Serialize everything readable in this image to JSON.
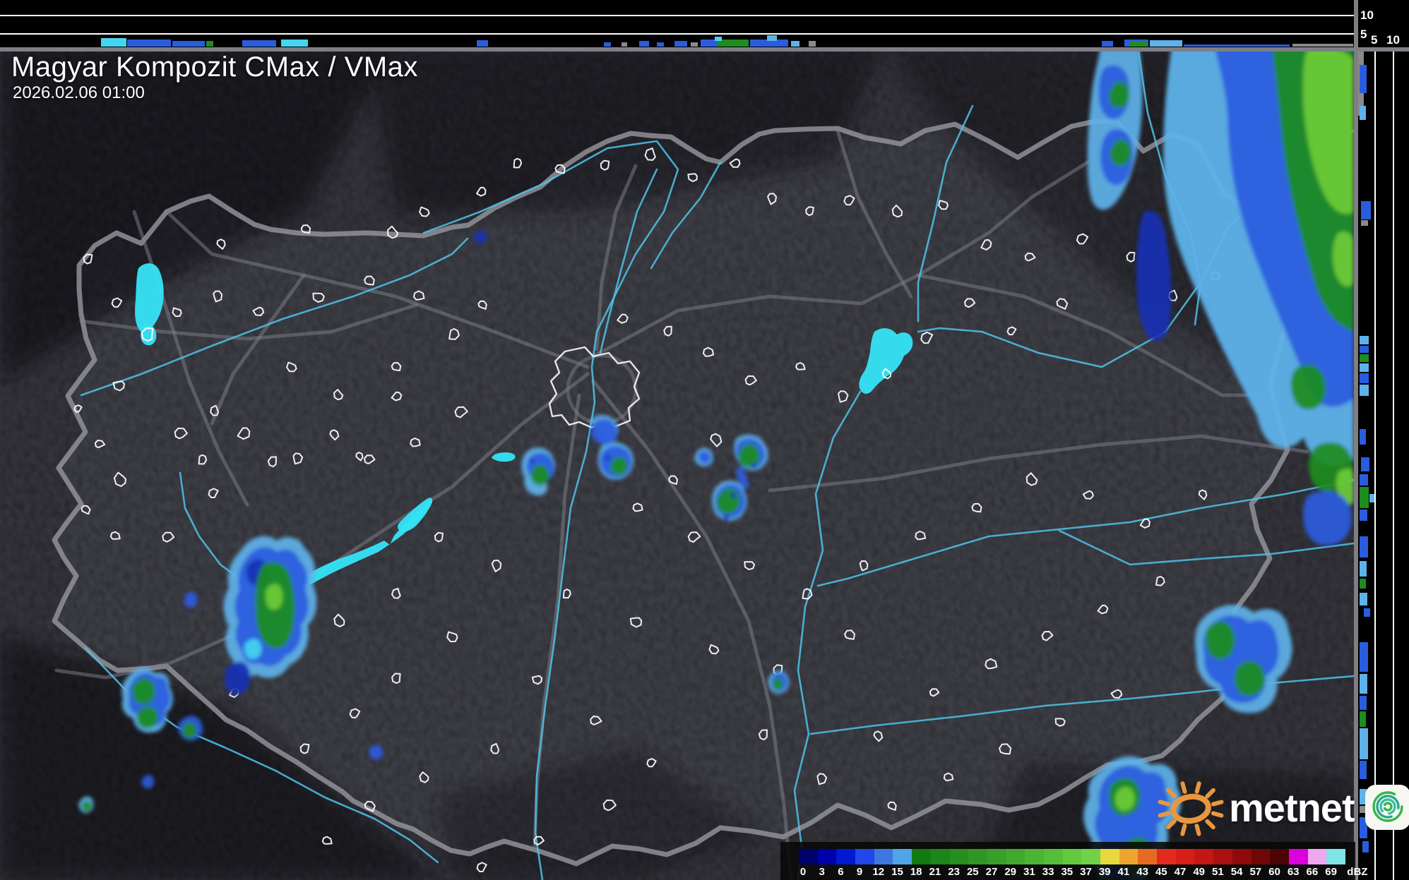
{
  "header": {
    "title": "Magyar Kompozit CMax / VMax",
    "timestamp": "2026.02.06 01:00"
  },
  "colorbar": {
    "unit": "dBZ",
    "ticks": [
      "0",
      "3",
      "6",
      "9",
      "12",
      "15",
      "18",
      "21",
      "23",
      "25",
      "27",
      "29",
      "31",
      "33",
      "35",
      "37",
      "39",
      "41",
      "43",
      "45",
      "47",
      "49",
      "51",
      "54",
      "57",
      "60",
      "63",
      "66",
      "69"
    ],
    "colors": [
      "#00006B",
      "#0000A8",
      "#0018CF",
      "#2346E8",
      "#3C78E0",
      "#4FA5E6",
      "#117A11",
      "#1E851B",
      "#278E20",
      "#309724",
      "#38A029",
      "#41AA2E",
      "#4BB434",
      "#55BE39",
      "#62C93F",
      "#70D246",
      "#E8D83C",
      "#EDA52F",
      "#E76A22",
      "#E22B1D",
      "#D81E18",
      "#C41714",
      "#AB1010",
      "#8F0B0B",
      "#6F0707",
      "#4A0404",
      "#DC00DC",
      "#EFA8EF",
      "#7FE4E4"
    ]
  },
  "profile_panels": {
    "top_axis_labels": [
      "10",
      "5"
    ],
    "right_axis_labels": [
      "5",
      "10"
    ]
  },
  "logo": {
    "text": "metnet",
    "sun_color": "#E8973F",
    "spiral_colors": [
      "#34B44A",
      "#2AA886",
      "#39BDA8"
    ]
  },
  "map_palette": {
    "background": "#3D3D45",
    "border": "#97979F",
    "road": "#80808A",
    "river": "#4FC3E8",
    "lake": "#35E2F5",
    "town_outline": "#FFFFFF",
    "echo_lightblue": "#5EB2EA",
    "echo_blue": "#2A5CDE",
    "echo_darkblue": "#1430B4",
    "echo_green": "#1E8C1E",
    "echo_green_bright": "#6CCB37",
    "echo_cyan": "#44D5F0",
    "echo_gray": "#8A8A8A"
  }
}
